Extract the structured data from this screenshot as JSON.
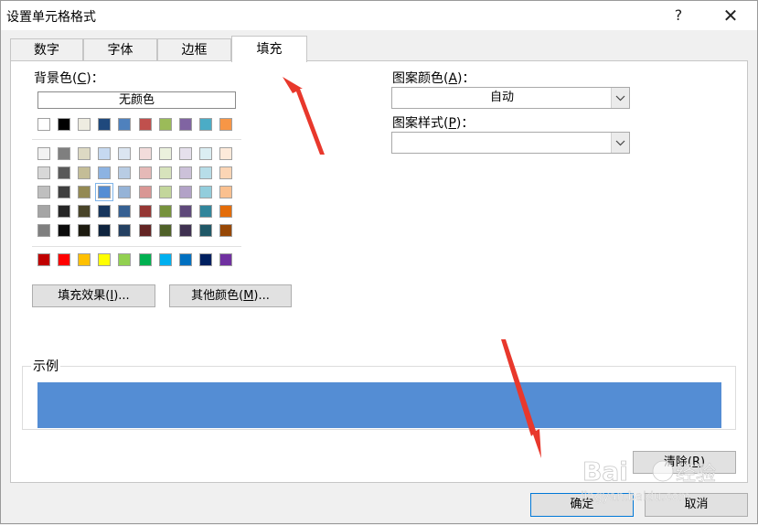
{
  "window": {
    "title": "设置单元格格式",
    "help": "?",
    "close": "✕"
  },
  "tabs": [
    {
      "label": "数字",
      "active": false
    },
    {
      "label": "字体",
      "active": false
    },
    {
      "label": "边框",
      "active": false
    },
    {
      "label": "填充",
      "active": true
    }
  ],
  "fill": {
    "background_label": "背景色(C)：",
    "no_color_label": "无颜色",
    "theme_top_row": [
      "#ffffff",
      "#000000",
      "#eeece1",
      "#1f497d",
      "#4f81bd",
      "#c0504d",
      "#9bbb59",
      "#8064a2",
      "#4bacc6",
      "#f79646"
    ],
    "theme_shades": [
      [
        "#f2f2f2",
        "#7f7f7f",
        "#ddd9c3",
        "#c6d9f0",
        "#dbe5f1",
        "#f2dcdb",
        "#ebf1dd",
        "#e5e0ec",
        "#dbeef3",
        "#fdeada"
      ],
      [
        "#d8d8d8",
        "#595959",
        "#c4bd97",
        "#8db3e2",
        "#b8cce4",
        "#e5b9b7",
        "#d7e3bc",
        "#ccc1d9",
        "#b7dde8",
        "#fbd5b5"
      ],
      [
        "#bfbfbf",
        "#3f3f3f",
        "#938953",
        "#548dd4",
        "#95b3d7",
        "#d99694",
        "#c3d69b",
        "#b2a2c7",
        "#92cddc",
        "#fac08f"
      ],
      [
        "#a5a5a5",
        "#262626",
        "#494429",
        "#17365d",
        "#366092",
        "#953734",
        "#76923c",
        "#5f497a",
        "#31859b",
        "#e36c09"
      ],
      [
        "#7f7f7f",
        "#0c0c0c",
        "#1d1b10",
        "#0f243e",
        "#244061",
        "#632423",
        "#4f6128",
        "#3f3151",
        "#205867",
        "#974806"
      ]
    ],
    "standard_colors": [
      "#c00000",
      "#ff0000",
      "#ffc000",
      "#ffff00",
      "#92d050",
      "#00b050",
      "#00b0f0",
      "#0070c0",
      "#002060",
      "#7030a0"
    ],
    "selected_color": "#548dd4",
    "fill_effects_button": "填充效果(I)...",
    "more_colors_button": "其他颜色(M)..."
  },
  "pattern": {
    "color_label": "图案颜色(A)：",
    "color_value": "自动",
    "style_label": "图案样式(P)：",
    "style_value": ""
  },
  "sample": {
    "label": "示例",
    "color": "#548dd4"
  },
  "buttons": {
    "clear": "清除(R)",
    "ok": "确定",
    "cancel": "取消"
  },
  "annotation_color": "#e8382c",
  "watermark": {
    "logo": "Baidu 经验",
    "url": "jingyan.baidu.com"
  }
}
